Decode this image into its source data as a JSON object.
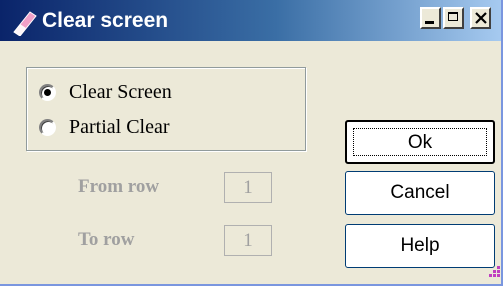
{
  "window": {
    "title": "Clear screen",
    "icon": "eraser-icon",
    "controls": [
      "minimize-icon",
      "maximize-icon",
      "close-icon"
    ]
  },
  "clear_mode": {
    "options": [
      {
        "label": "Clear Screen",
        "selected": true
      },
      {
        "label": "Partial Clear",
        "selected": false
      }
    ]
  },
  "fields": {
    "from_row": {
      "label": "From row",
      "value": "1",
      "enabled": false
    },
    "to_row": {
      "label": "To row",
      "value": "1",
      "enabled": false
    }
  },
  "buttons": {
    "ok": "Ok",
    "cancel": "Cancel",
    "help": "Help"
  },
  "colors": {
    "titlebar_start": "#0a246a",
    "titlebar_end": "#a6caf0",
    "dialog_bg": "#ece9d8",
    "disabled_text": "#a0a0a0"
  }
}
